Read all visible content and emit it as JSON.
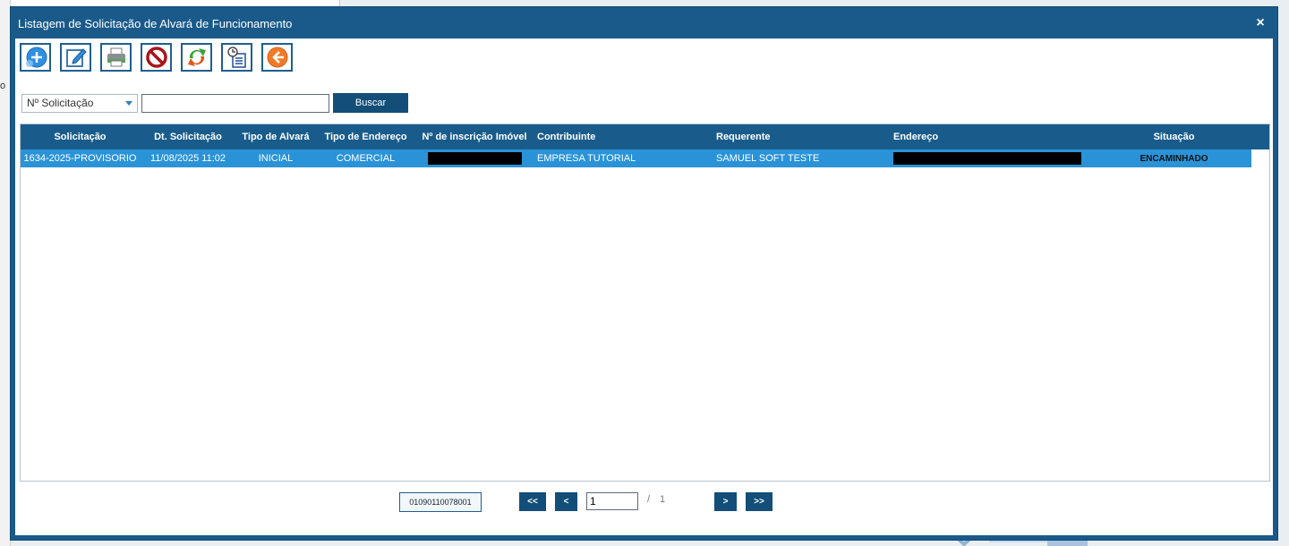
{
  "window": {
    "title": "Listagem de Solicitação de Alvará de Funcionamento",
    "close_label": "×"
  },
  "toolbar": [
    {
      "name": "add",
      "icon": "add-icon"
    },
    {
      "name": "edit",
      "icon": "edit-icon"
    },
    {
      "name": "print",
      "icon": "print-icon"
    },
    {
      "name": "cancel",
      "icon": "cancel-icon"
    },
    {
      "name": "refresh",
      "icon": "refresh-icon"
    },
    {
      "name": "history",
      "icon": "history-icon"
    },
    {
      "name": "back",
      "icon": "back-icon"
    }
  ],
  "search": {
    "filter_selected": "Nº Solicitação",
    "input_value": "",
    "button_label": "Buscar"
  },
  "grid": {
    "columns": [
      "Solicitação",
      "Dt. Solicitação",
      "Tipo de Alvará",
      "Tipo de Endereço",
      "Nº de inscrição Imóvel",
      "Contribuinte",
      "Requerente",
      "Endereço",
      "Situação"
    ],
    "rows": [
      {
        "solicitacao": "1634-2025-PROVISORIO",
        "dt_solicitacao": "11/08/2025 11:02",
        "tipo_alvara": "INICIAL",
        "tipo_endereco": "COMERCIAL",
        "inscricao_imovel": "",
        "contribuinte": "EMPRESA TUTORIAL",
        "requerente": "SAMUEL SOFT TESTE",
        "endereco": "",
        "situacao": "ENCAMINHADO"
      }
    ]
  },
  "pager": {
    "code": "01090110078001",
    "first_label": "<<",
    "prev_label": "<",
    "current_page": "1",
    "separator": "/",
    "total_pages": "1",
    "next_label": ">",
    "last_label": ">>"
  },
  "background": {
    "left_letter": "o"
  },
  "colors": {
    "window_frame": "#1a5a8a",
    "header_bg": "#195c8c",
    "selected_row": "#2a93d8",
    "button_bg": "#124e78"
  }
}
